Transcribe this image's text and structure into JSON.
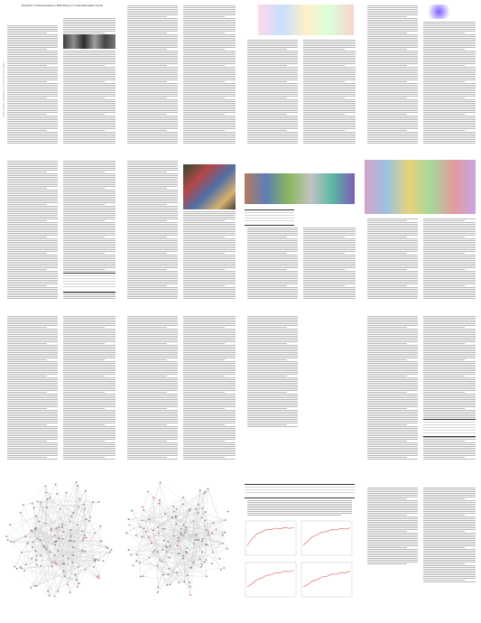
{
  "document": {
    "title": "Explicit Correspondence Matching for Generalizable Neural Radiance Fields",
    "arxiv_stamp": "arXiv:2304.12294v1 [cs.CV] 24 Apr 2023",
    "pages": [
      {
        "label": "page-1",
        "sections": [
          "Abstract",
          "1. Introduction"
        ]
      },
      {
        "label": "page-2",
        "sections": [
          "2. Related Work"
        ]
      },
      {
        "label": "page-3",
        "sections": [
          "3. Approach"
        ]
      },
      {
        "label": "page-4",
        "sections": [
          "3.3. Rendering"
        ]
      },
      {
        "label": "page-5",
        "sections": [
          "4. Experiments"
        ]
      },
      {
        "label": "page-6",
        "sections": [
          "4.2. Main Results"
        ]
      },
      {
        "label": "page-7",
        "sections": [
          "5. Conclusion"
        ]
      },
      {
        "label": "page-8",
        "sections": [
          "References"
        ]
      },
      {
        "label": "page-9",
        "sections": [
          "Appendix"
        ]
      },
      {
        "label": "page-10",
        "sections": []
      },
      {
        "label": "page-11",
        "sections": []
      },
      {
        "label": "page-12",
        "sections": []
      }
    ]
  }
}
